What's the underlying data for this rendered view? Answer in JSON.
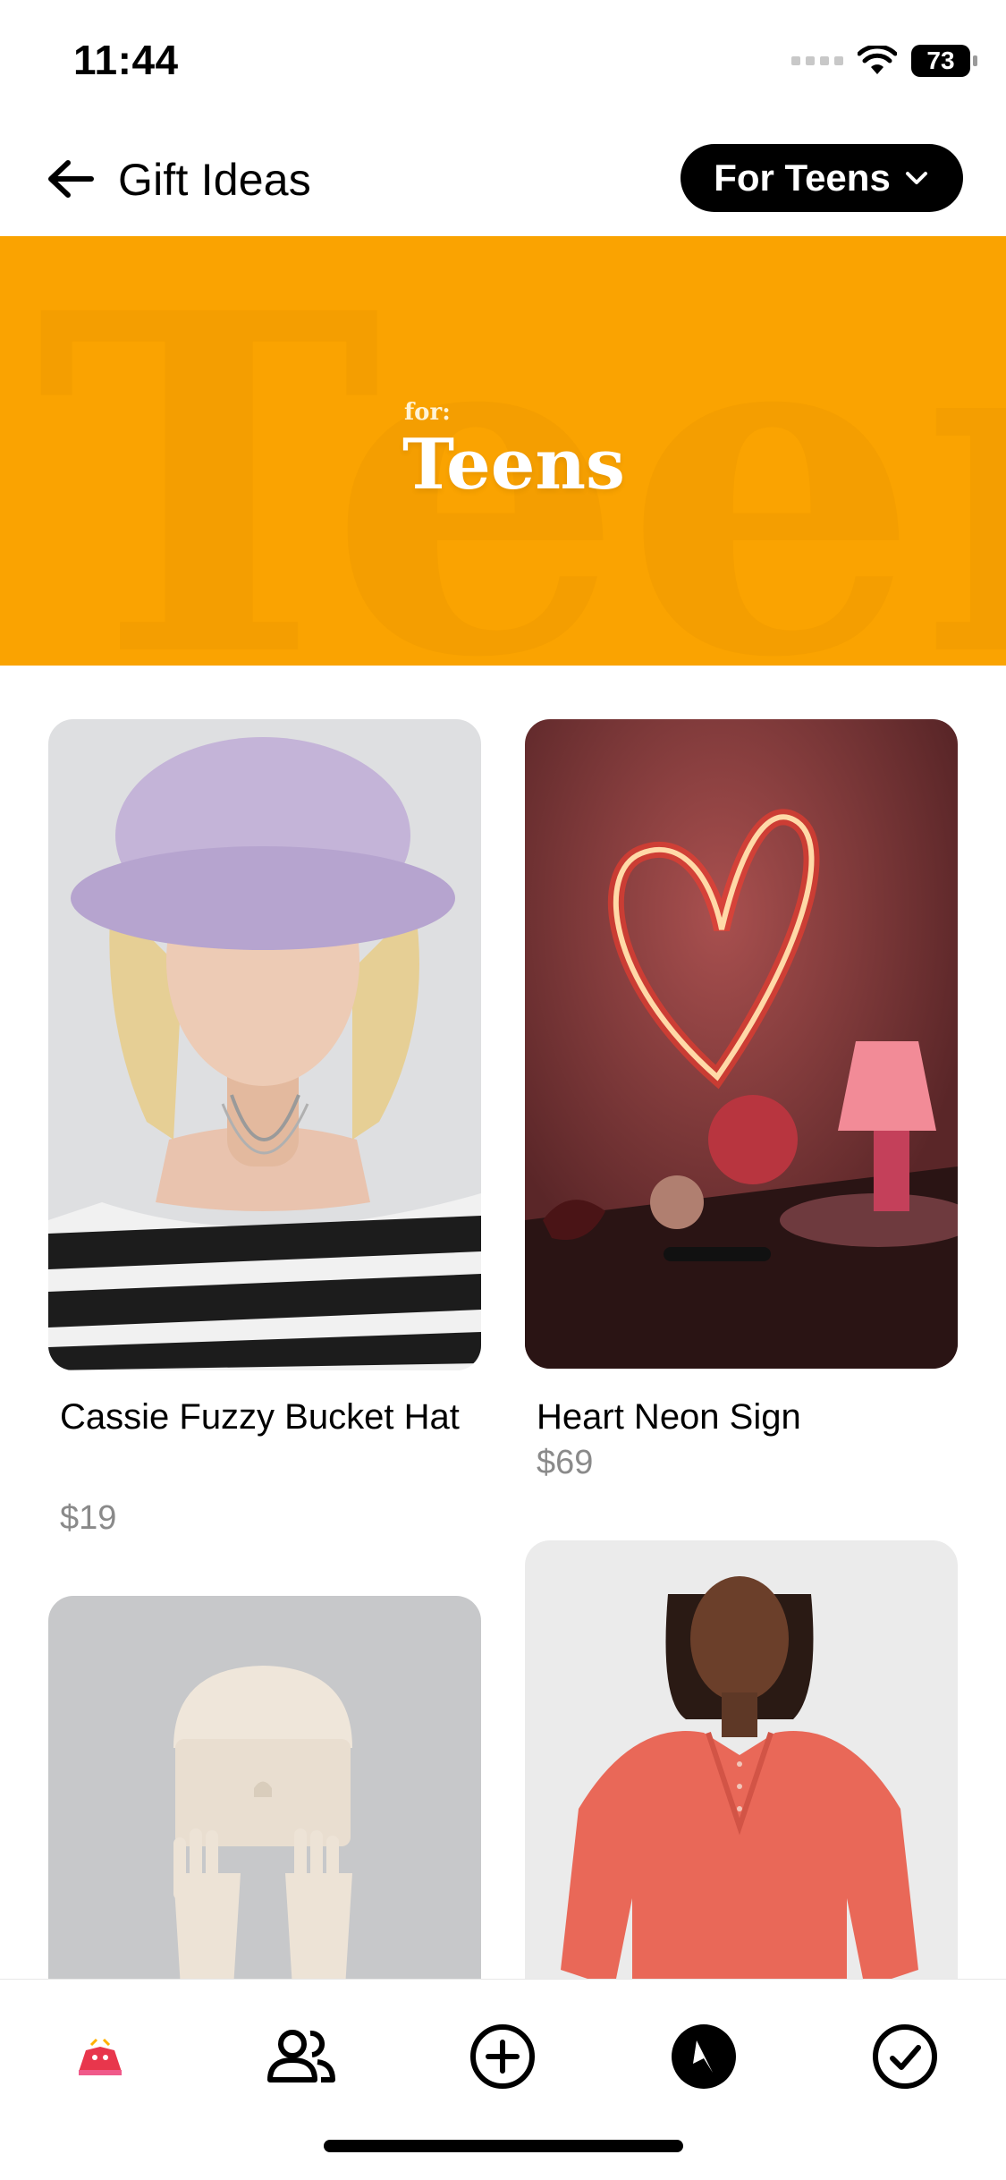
{
  "status": {
    "time": "11:44",
    "battery": "73"
  },
  "nav": {
    "title": "Gift Ideas",
    "filter_label": "For Teens"
  },
  "hero": {
    "prefix": "for:",
    "title": "Teens",
    "bg_color": "#FAA301"
  },
  "products": [
    {
      "name": "Cassie Fuzzy Bucket Hat",
      "price": "$19"
    },
    {
      "name": "Heart Neon Sign",
      "price": "$69"
    }
  ],
  "tabs": [
    {
      "icon": "gift-mascot-icon"
    },
    {
      "icon": "people-icon"
    },
    {
      "icon": "plus-circle-icon"
    },
    {
      "icon": "compass-icon"
    },
    {
      "icon": "check-circle-icon"
    }
  ]
}
